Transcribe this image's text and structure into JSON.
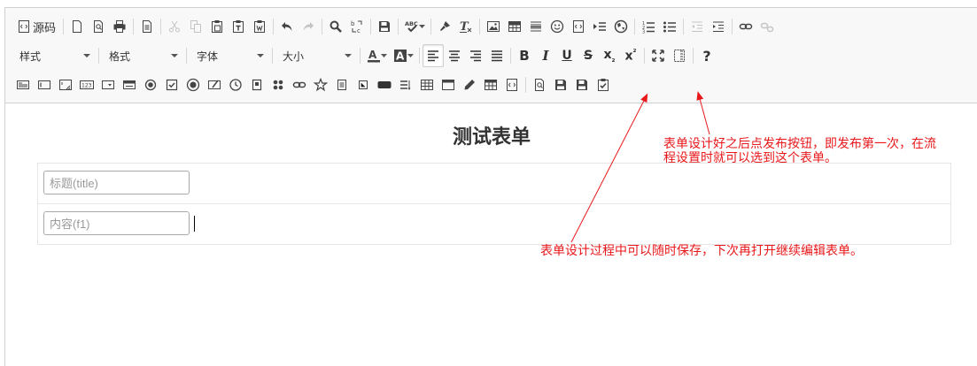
{
  "toolbar": {
    "source_label": "源码",
    "style_combo": "样式",
    "format_combo": "格式",
    "font_combo": "字体",
    "size_combo": "大小",
    "help_label": "?"
  },
  "form": {
    "title": "测试表单",
    "fields": [
      {
        "placeholder": "标题(title)"
      },
      {
        "placeholder": "内容(f1)"
      }
    ]
  },
  "annotations": {
    "publish_line1": "表单设计好之后点发布按钮，即发布第一次，在流",
    "publish_line2": "程设置时就可以选到这个表单。",
    "save_note": "表单设计过程中可以随时保存，下次再打开继续编辑表单。"
  },
  "colors": {
    "annotation": "#e8181b",
    "toolbar_bg": "#f8f8f8"
  }
}
